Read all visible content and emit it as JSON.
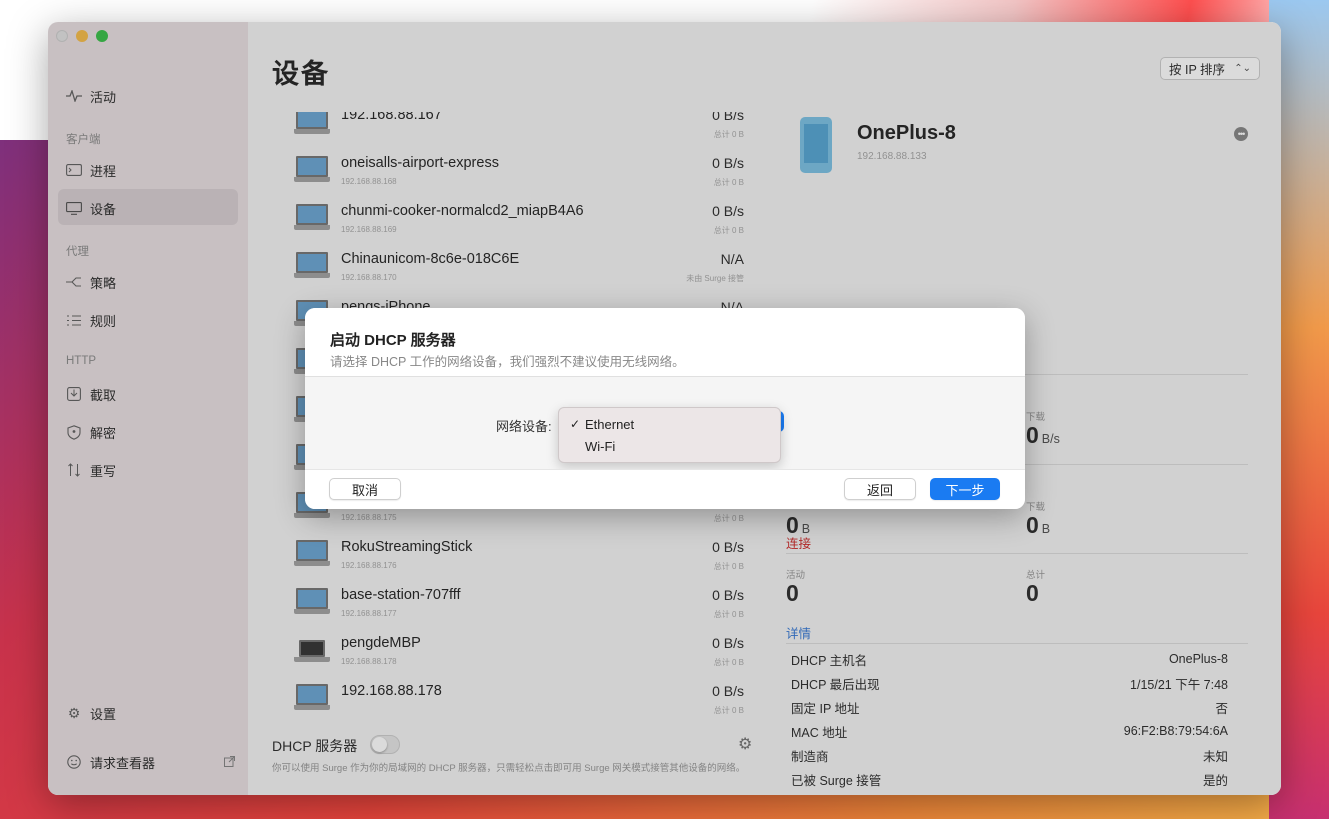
{
  "sidebar": {
    "activity": "活动",
    "section_client": "客户端",
    "process": "进程",
    "devices": "设备",
    "section_proxy": "代理",
    "policy": "策略",
    "rules": "规则",
    "section_http": "HTTP",
    "capture": "截取",
    "decrypt": "解密",
    "rewrite": "重写",
    "settings": "设置",
    "request_viewer": "请求查看器"
  },
  "main": {
    "title": "设备",
    "sort_label": "按 IP 排序",
    "devices": [
      {
        "name": "192.168.88.167",
        "ip": "",
        "rate": "0 B/s",
        "total": "总计 0 B"
      },
      {
        "name": "oneisalls-airport-express",
        "ip": "192.168.88.168",
        "rate": "0 B/s",
        "total": "总计 0 B"
      },
      {
        "name": "chunmi-cooker-normalcd2_miapB4A6",
        "ip": "192.168.88.169",
        "rate": "0 B/s",
        "total": "总计 0 B"
      },
      {
        "name": "Chinaunicom-8c6e-018C6E",
        "ip": "192.168.88.170",
        "rate": "N/A",
        "total": "未由 Surge 接管"
      },
      {
        "name": "pengs-iPhone",
        "ip": "",
        "rate": "N/A",
        "total": ""
      },
      {
        "name": "",
        "ip": "",
        "rate": "",
        "total": ""
      },
      {
        "name": "",
        "ip": "",
        "rate": "",
        "total": ""
      },
      {
        "name": "",
        "ip": "",
        "rate": "",
        "total": ""
      },
      {
        "name": "",
        "ip": "192.168.88.175",
        "rate": "",
        "total": "总计 0 B"
      },
      {
        "name": "RokuStreamingStick",
        "ip": "192.168.88.176",
        "rate": "0 B/s",
        "total": "总计 0 B"
      },
      {
        "name": "base-station-707fff",
        "ip": "192.168.88.177",
        "rate": "0 B/s",
        "total": "总计 0 B"
      },
      {
        "name": "pengdeMBP",
        "ip": "192.168.88.178",
        "rate": "0 B/s",
        "total": "总计 0 B"
      },
      {
        "name": "192.168.88.178",
        "ip": "",
        "rate": "0 B/s",
        "total": "总计 0 B"
      }
    ],
    "dhcp_label": "DHCP 服务器",
    "dhcp_desc": "你可以使用 Surge 作为你的局域网的 DHCP 服务器，只需轻松点击即可用 Surge 网关模式接管其他设备的网络。"
  },
  "detail": {
    "device_name": "OnePlus-8",
    "device_ip": "192.168.88.133",
    "more": "•••",
    "download_label_1": "下载",
    "download_value_1": "0",
    "download_unit_1": "B/s",
    "upload_value_2": "0",
    "upload_unit_2": "B",
    "download_label_2": "下载",
    "download_value_2": "0",
    "download_unit_2b": "B",
    "connections_title": "连接",
    "active_label": "活动",
    "active_value": "0",
    "total_label": "总计",
    "total_value": "0",
    "details_title": "详情",
    "rows": [
      {
        "k": "DHCP 主机名",
        "v": "OnePlus-8"
      },
      {
        "k": "DHCP 最后出现",
        "v": "1/15/21 下午 7:48"
      },
      {
        "k": "固定 IP 地址",
        "v": "否"
      },
      {
        "k": "MAC 地址",
        "v": "96:F2:B8:79:54:6A"
      },
      {
        "k": "制造商",
        "v": "未知"
      },
      {
        "k": "已被 Surge 接管",
        "v": "是的"
      }
    ]
  },
  "modal": {
    "title": "启动 DHCP 服务器",
    "subtitle": "请选择 DHCP 工作的网络设备，我们强烈不建议使用无线网络。",
    "field_label": "网络设备:",
    "options": [
      "Ethernet",
      "Wi-Fi"
    ],
    "selected": "Ethernet",
    "check": "✓",
    "cancel": "取消",
    "back": "返回",
    "next": "下一步"
  },
  "colors": {
    "accent": "#1a7bf2",
    "connections_red": "#d03030",
    "details_blue": "#3a7bd5"
  }
}
